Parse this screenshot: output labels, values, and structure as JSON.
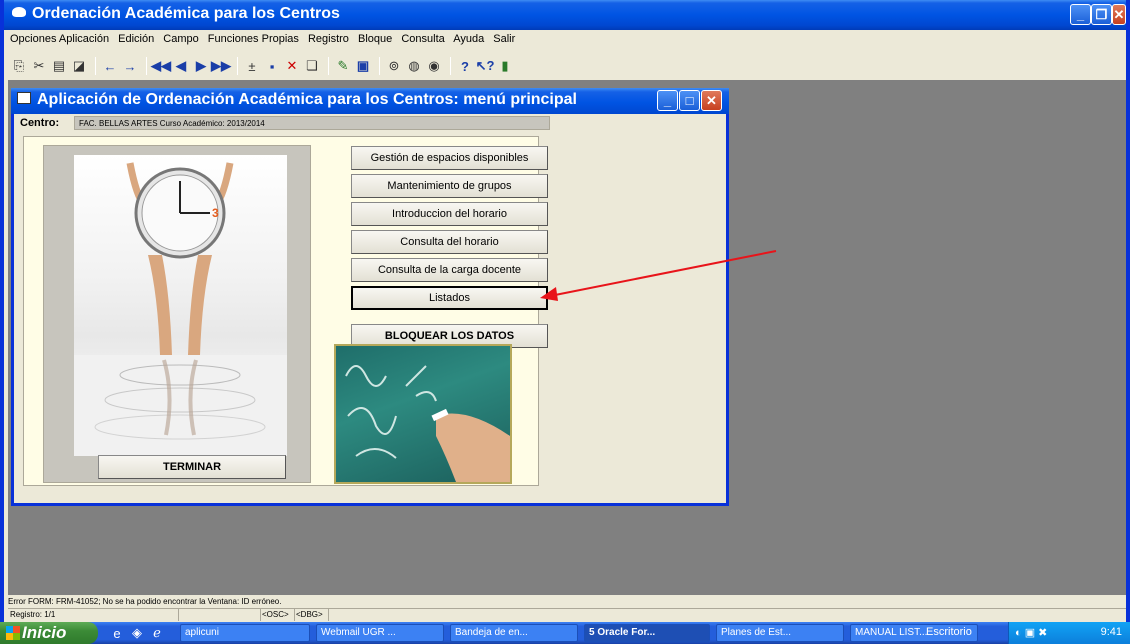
{
  "app": {
    "title": "Ordenación Académica para los Centros",
    "menu": [
      "Opciones Aplicación",
      "Edición",
      "Campo",
      "Funciones Propias",
      "Registro",
      "Bloque",
      "Consulta",
      "Ayuda",
      "Salir"
    ]
  },
  "inner_window": {
    "title": "Aplicación de Ordenación Académica para los Centros: menú principal",
    "centro_label": "Centro:",
    "centro_value": "FAC. BELLAS ARTES Curso Académico: 2013/2014"
  },
  "buttons": {
    "gestion": "Gestión de espacios disponibles",
    "mantenimiento": "Mantenimiento de grupos",
    "introduccion": "Introduccion del horario",
    "consulta_horario": "Consulta del horario",
    "consulta_carga": "Consulta de la carga docente",
    "listados": "Listados",
    "bloquear": "BLOQUEAR LOS DATOS",
    "terminar": "TERMINAR"
  },
  "status": {
    "error": "Error FORM: FRM-41052; No se ha podido encontrar la Ventana: ID erróneo.",
    "registro": "Registro: 1/1",
    "osc": "<OSC>",
    "dbg": "<DBG>"
  },
  "taskbar": {
    "start": "Inicio",
    "tasks": [
      "aplicuni",
      "Webmail UGR ...",
      "Bandeja de en...",
      "5 Oracle For...",
      "Planes de Est...",
      "MANUAL LIST..."
    ],
    "escritorio": "Escritorio",
    "time": "9:41"
  },
  "colors": {
    "title_blue": "#0054e3",
    "panel_bg": "#fffde6",
    "annotation_arrow": "#e8141a"
  }
}
